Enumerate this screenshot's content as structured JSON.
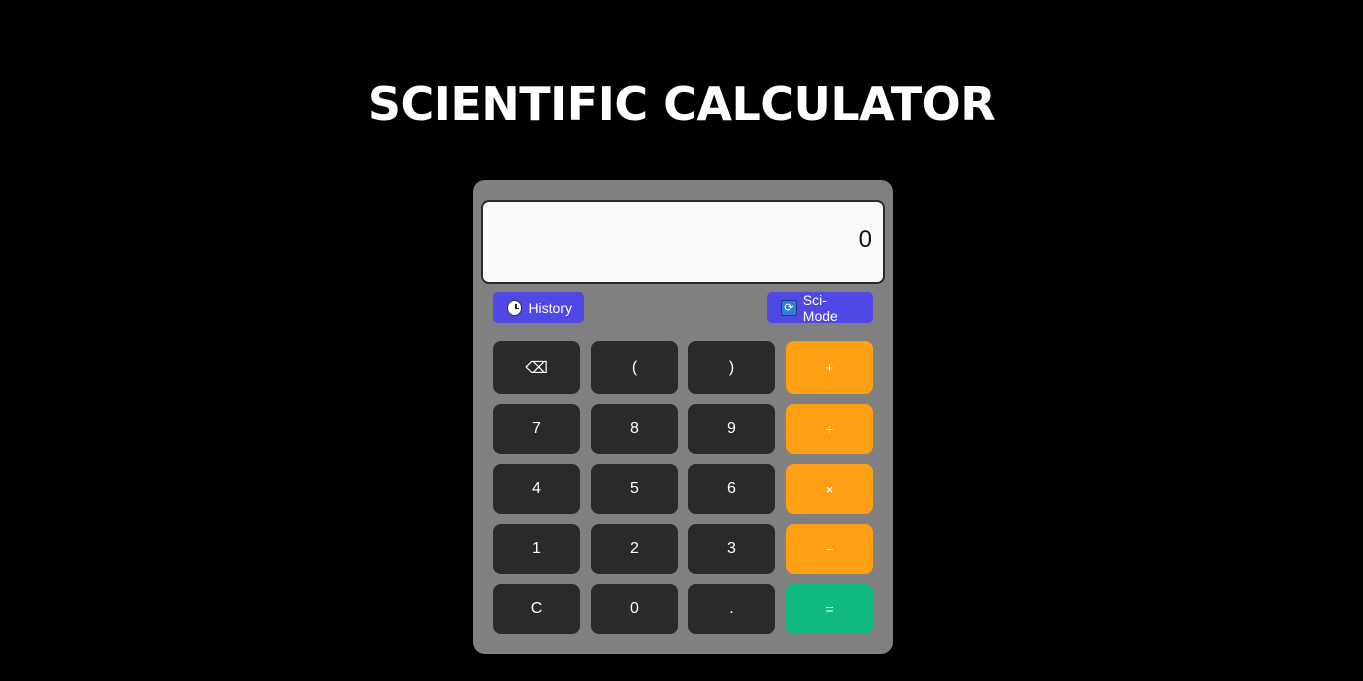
{
  "page": {
    "title": "SCIENTIFIC CALCULATOR"
  },
  "display": {
    "value": "0"
  },
  "toolbar": {
    "history_label": "History",
    "history_icon": "clock-icon",
    "scimode_label": "Sci-Mode",
    "scimode_icon": "swap-icon"
  },
  "keys": {
    "backspace": "⌫",
    "open_paren": "(",
    "close_paren": ")",
    "plus": "+",
    "seven": "7",
    "eight": "8",
    "nine": "9",
    "divide": "÷",
    "four": "4",
    "five": "5",
    "six": "6",
    "multiply": "×",
    "one": "1",
    "two": "2",
    "three": "3",
    "minus": "−",
    "clear": "C",
    "zero": "0",
    "decimal": ".",
    "equals": "="
  },
  "colors": {
    "background": "#000000",
    "panel": "#808080",
    "key": "#2a2a2c",
    "operator": "#ff9f14",
    "equals": "#10b981",
    "accent": "#5048e5"
  }
}
